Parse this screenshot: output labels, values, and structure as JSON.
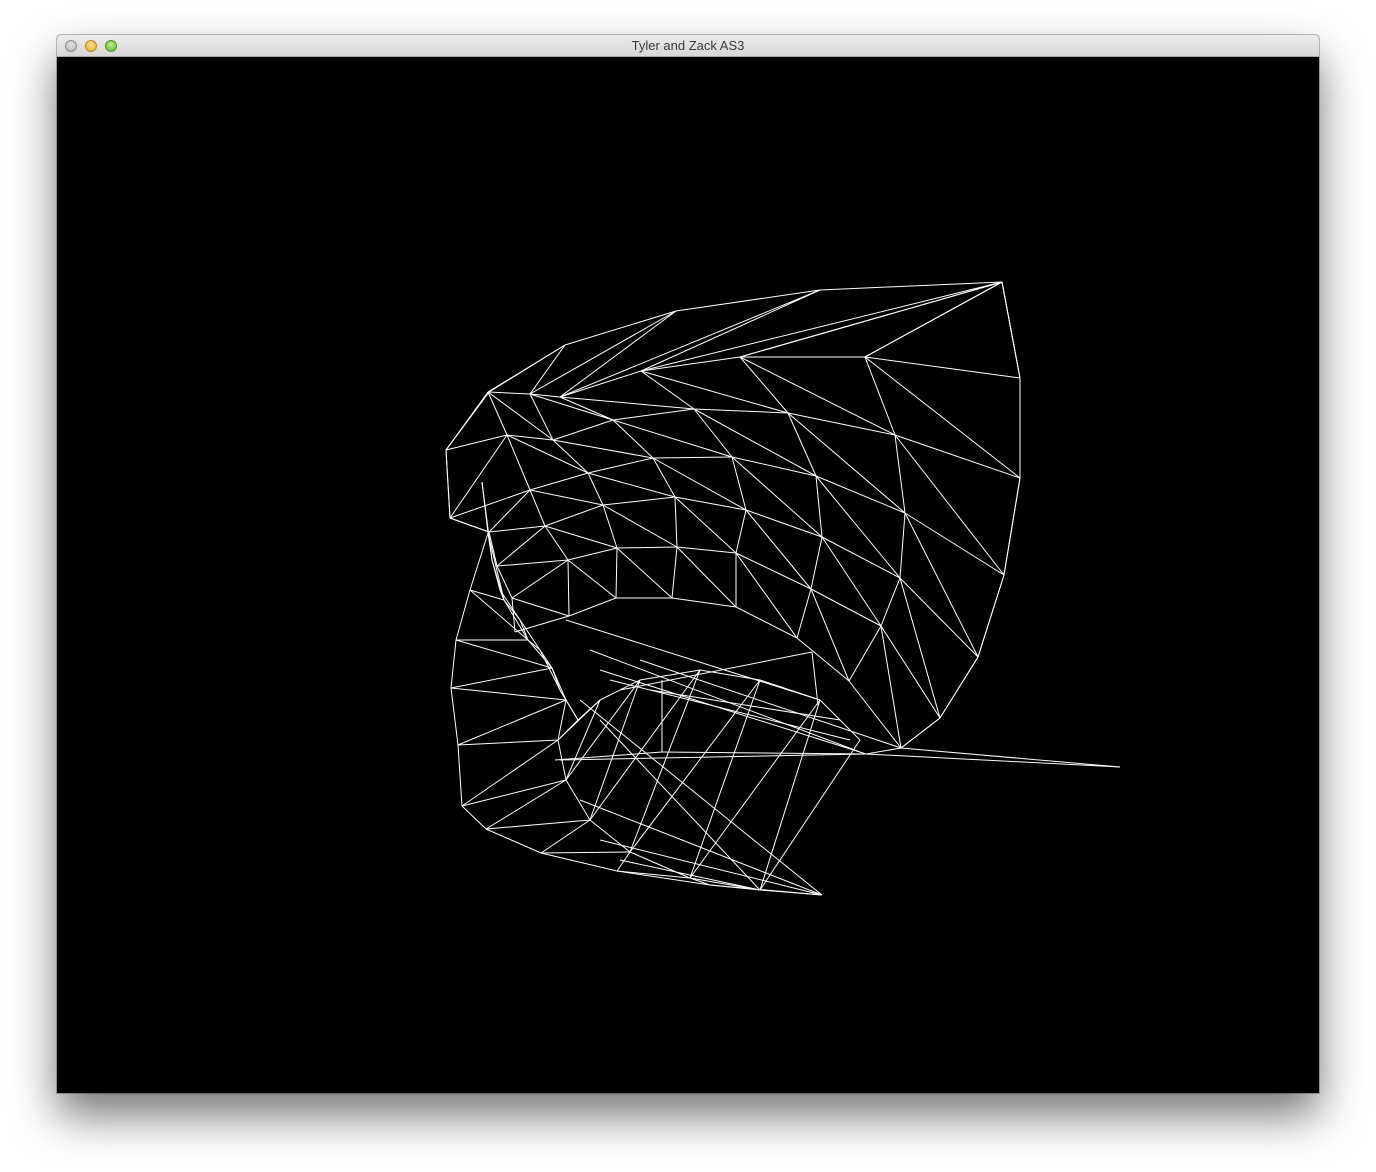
{
  "window": {
    "title": "Tyler and Zack AS3"
  },
  "viewport": {
    "background": "#000000",
    "wire_color": "#ffffff",
    "content": "wireframe-mesh"
  },
  "colors": {
    "close": "#c8c8c8",
    "minimize": "#f5c242",
    "maximize": "#7bd24a"
  }
}
